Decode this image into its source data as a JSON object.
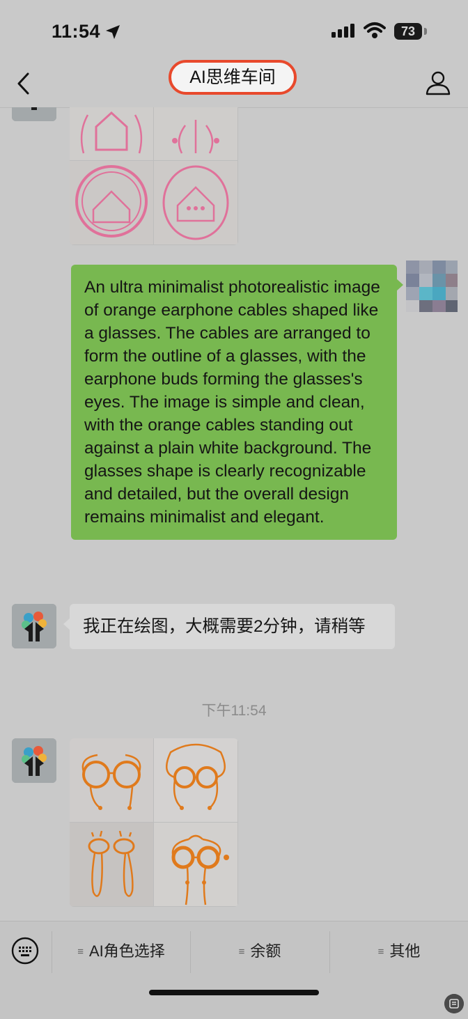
{
  "status_bar": {
    "time": "11:54",
    "battery": "73"
  },
  "header": {
    "title": "AI思维车间"
  },
  "messages": {
    "user_prompt": "An ultra minimalist photorealistic image of orange earphone cables shaped like a glasses. The cables are arranged to form the outline of a  glasses, with the earphone buds forming the glasses's eyes. The image is simple and clean, with the orange cables standing out against a plain white background. The glasses shape is clearly recognizable and detailed, but the overall design remains minimalist and elegant.",
    "bot_reply": "我正在绘图，大概需要2分钟，请稍等",
    "timestamp": "下午11:54"
  },
  "bottom_menu": {
    "items": [
      {
        "label": "AI角色选择"
      },
      {
        "label": "余额"
      },
      {
        "label": "其他"
      }
    ]
  },
  "colors": {
    "accent_circle": "#e8492c",
    "bubble_green": "#78b850",
    "pink_cable": "#e0719a",
    "orange_cable": "#e07a1c"
  }
}
